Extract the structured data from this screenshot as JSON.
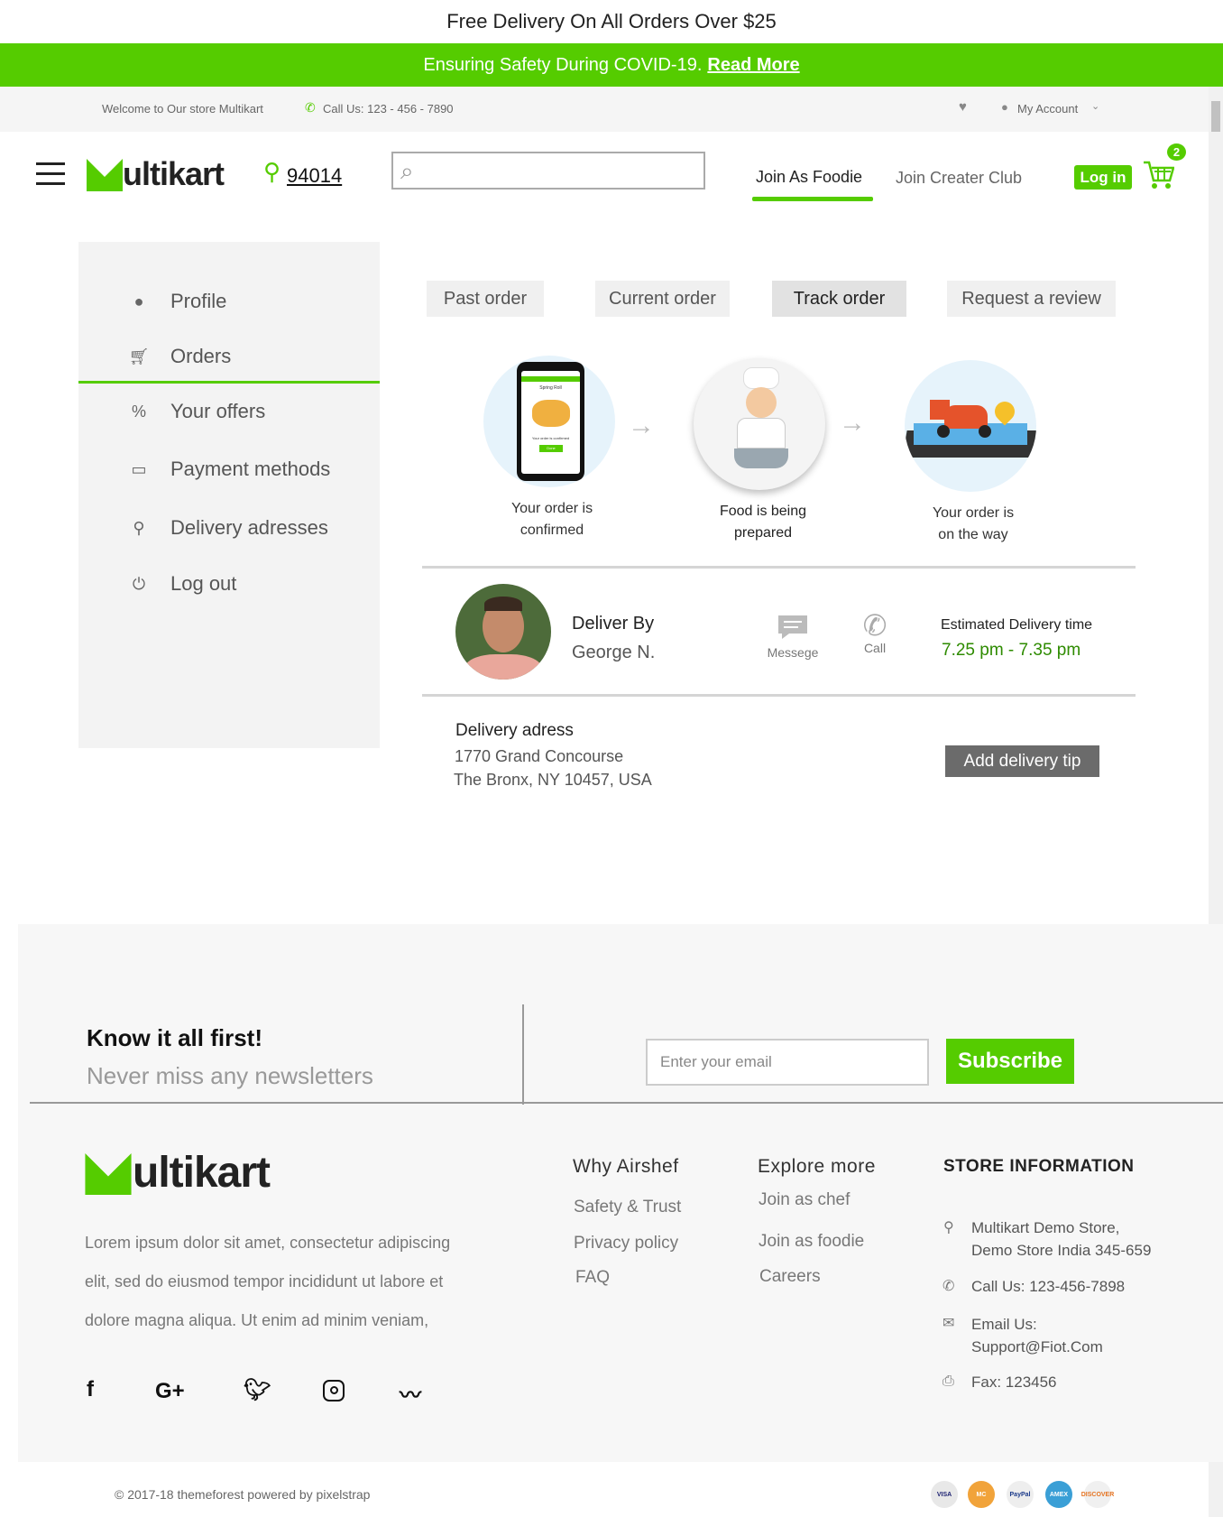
{
  "promo": {
    "text": "Free Delivery On All Orders Over $25"
  },
  "covid": {
    "text": "Ensuring Safety During COVID-19.",
    "link": "Read More"
  },
  "topbar": {
    "welcome": "Welcome to Our store Multikart",
    "call": "Call Us: 123 - 456 - 7890",
    "account": "My Account"
  },
  "header": {
    "logo": "Multikart",
    "zip": "94014",
    "nav": [
      "Join As Foodie",
      "Join Creater Club"
    ],
    "login": "Log in",
    "cart_count": "2"
  },
  "sidebar": {
    "items": [
      {
        "label": "Profile",
        "icon": "user-icon"
      },
      {
        "label": "Orders",
        "icon": "cart-icon"
      },
      {
        "label": "Your offers",
        "icon": "percent-icon"
      },
      {
        "label": "Payment methods",
        "icon": "card-icon"
      },
      {
        "label": "Delivery adresses",
        "icon": "pin-icon"
      },
      {
        "label": "Log out",
        "icon": "power-icon"
      }
    ],
    "active": "Orders"
  },
  "tabs": [
    {
      "label": "Past order"
    },
    {
      "label": "Current order"
    },
    {
      "label": "Track order"
    },
    {
      "label": "Request a review"
    }
  ],
  "active_tab": "Track order",
  "steps": [
    {
      "line1": "Your order is",
      "line2": "confirmed"
    },
    {
      "line1": "Food is being",
      "line2": "prepared"
    },
    {
      "line1": "Your order is",
      "line2": "on the way"
    }
  ],
  "phone": {
    "header": "Spring Roll",
    "status": "Your order is confirmed",
    "button": "Done"
  },
  "delivery": {
    "by_label": "Deliver By",
    "name": "George N.",
    "message": "Messege",
    "call": "Call",
    "eta_label": "Estimated Delivery time",
    "eta_value": "7.25 pm - 7.35 pm"
  },
  "address": {
    "title": "Delivery adress",
    "line1": "1770 Grand Concourse",
    "line2": "The Bronx, NY 10457, USA",
    "tip_button": "Add delivery tip"
  },
  "newsletter": {
    "title": "Know it all first!",
    "subtitle": "Never miss any newsletters",
    "placeholder": "Enter your email",
    "button": "Subscribe"
  },
  "footer": {
    "logo": "Multikart",
    "about": [
      "Lorem ipsum dolor sit amet, consectetur adipiscing",
      "elit, sed do eiusmod tempor incididunt ut labore et",
      "dolore magna aliqua. Ut enim ad minim veniam,"
    ],
    "col1": {
      "title": "Why Airshef",
      "links": [
        "Safety & Trust",
        "Privacy policy",
        "FAQ"
      ]
    },
    "col2": {
      "title": "Explore more",
      "links": [
        "Join as chef",
        "Join as foodie",
        "Careers"
      ]
    },
    "store": {
      "title": "STORE INFORMATION",
      "address1": "Multikart Demo Store,",
      "address2": "Demo Store India 345-659",
      "call": "Call Us: 123-456-7898",
      "email_label": "Email Us:",
      "email": "Support@Fiot.Com",
      "fax": "Fax: 123456"
    },
    "social": [
      "f",
      "G+",
      "twitter",
      "instagram",
      "rss"
    ],
    "copyright": "© 2017-18 themeforest powered by pixelstrap",
    "payments": [
      "VISA",
      "MC",
      "PayPal",
      "AMEX",
      "DISCOVER"
    ]
  },
  "colors": {
    "accent": "#55cc00",
    "eta": "#2e8b00"
  }
}
